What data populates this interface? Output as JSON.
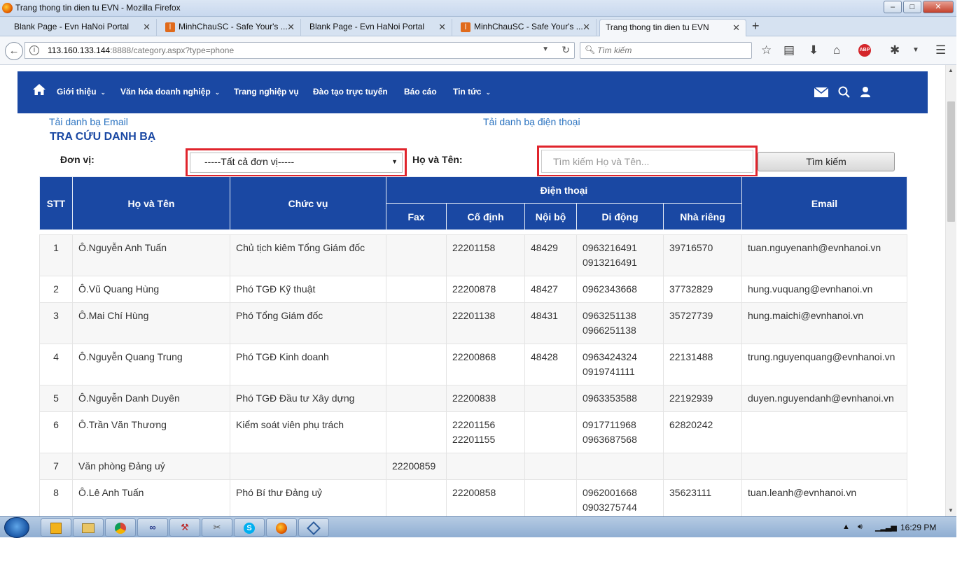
{
  "window": {
    "title": "Trang thong tin dien tu EVN - Mozilla Firefox",
    "minimize": "–",
    "maximize": "□",
    "close": "✕"
  },
  "tabs": [
    {
      "label": "Blank Page - Evn HaNoi Portal",
      "icon": "page-icon",
      "active": false
    },
    {
      "label": "MinhChauSC - Safe Your's ...",
      "icon": "xampp-icon",
      "active": false
    },
    {
      "label": "Blank Page - Evn HaNoi Portal",
      "icon": "page-icon",
      "active": false
    },
    {
      "label": "MinhChauSC - Safe Your's ...",
      "icon": "xampp-icon",
      "active": false
    },
    {
      "label": "Trang thong tin dien tu EVN",
      "icon": "page-icon",
      "active": true
    }
  ],
  "toolbar": {
    "url_host": "113.160.133.144",
    "url_rest": ":8888/category.aspx?type=phone",
    "search_placeholder": "Tìm kiếm"
  },
  "site": {
    "nav_items": [
      {
        "label": "Giới thiệu",
        "has_caret": true
      },
      {
        "label": "Văn hóa doanh nghiệp",
        "has_caret": true
      },
      {
        "label": "Trang nghiệp vụ",
        "has_caret": false
      },
      {
        "label": "Đào tạo trực tuyến",
        "has_caret": false
      },
      {
        "label": "Báo cáo",
        "has_caret": false
      },
      {
        "label": "Tin tức",
        "has_caret": true
      }
    ],
    "brand_color": "#1a48a3"
  },
  "content": {
    "download_email": "Tải danh bạ Email",
    "download_phone": "Tải danh bạ điện thoại",
    "heading": "TRA CỨU DANH BẠ",
    "unit_label": "Đơn vị:",
    "unit_selected": "-----Tất cả đơn vị-----",
    "name_label": "Họ và Tên:",
    "name_placeholder": "Tìm kiếm Họ và Tên...",
    "search_button": "Tìm kiếm"
  },
  "table": {
    "headers": {
      "stt": "STT",
      "name": "Họ và Tên",
      "position": "Chức vụ",
      "phone_group": "Điện thoại",
      "fax": "Fax",
      "landline": "Cố định",
      "internal": "Nội bộ",
      "mobile": "Di động",
      "home": "Nhà riêng",
      "email": "Email"
    },
    "rows": [
      {
        "stt": "1",
        "name": "Ô.Nguyễn Anh Tuấn",
        "position": "Chủ tịch kiêm Tổng Giám đốc",
        "fax": "",
        "landline": [
          "22201158"
        ],
        "internal": "48429",
        "mobile": [
          "0963216491",
          "0913216491"
        ],
        "home": "39716570",
        "email": "tuan.nguyenanh@evnhanoi.vn"
      },
      {
        "stt": "2",
        "name": "Ô.Vũ Quang Hùng",
        "position": "Phó TGĐ Kỹ thuật",
        "fax": "",
        "landline": [
          "22200878"
        ],
        "internal": "48427",
        "mobile": [
          "0962343668"
        ],
        "home": "37732829",
        "email": "hung.vuquang@evnhanoi.vn"
      },
      {
        "stt": "3",
        "name": "Ô.Mai Chí Hùng",
        "position": "Phó Tổng Giám đốc",
        "fax": "",
        "landline": [
          "22201138"
        ],
        "internal": "48431",
        "mobile": [
          "0963251138",
          "0966251138"
        ],
        "home": "35727739",
        "email": "hung.maichi@evnhanoi.vn"
      },
      {
        "stt": "4",
        "name": "Ô.Nguyễn Quang Trung",
        "position": "Phó TGĐ Kinh doanh",
        "fax": "",
        "landline": [
          "22200868"
        ],
        "internal": "48428",
        "mobile": [
          "0963424324",
          "0919741111"
        ],
        "home": "22131488",
        "email": "trung.nguyenquang@evnhanoi.vn"
      },
      {
        "stt": "5",
        "name": "Ô.Nguyễn Danh Duyên",
        "position": "Phó TGĐ Đầu tư Xây dựng",
        "fax": "",
        "landline": [
          "22200838"
        ],
        "internal": "",
        "mobile": [
          "0963353588"
        ],
        "home": "22192939",
        "email": "duyen.nguyendanh@evnhanoi.vn"
      },
      {
        "stt": "6",
        "name": "Ô.Trần Văn Thương",
        "position": "Kiểm soát viên phụ trách",
        "fax": "",
        "landline": [
          "22201156",
          "22201155"
        ],
        "internal": "",
        "mobile": [
          "0917711968",
          "0963687568"
        ],
        "home": "62820242",
        "email": ""
      },
      {
        "stt": "7",
        "name": "Văn phòng Đảng uỷ",
        "position": "",
        "fax": "22200859",
        "landline": [],
        "internal": "",
        "mobile": [],
        "home": "",
        "email": ""
      },
      {
        "stt": "8",
        "name": "Ô.Lê Anh Tuấn",
        "position": "Phó Bí thư Đảng uỷ",
        "fax": "",
        "landline": [
          "22200858"
        ],
        "internal": "",
        "mobile": [
          "0962001668",
          "0903275744"
        ],
        "home": "35623111",
        "email": "tuan.leanh@evnhanoi.vn"
      }
    ]
  },
  "taskbar": {
    "apps": [
      "outlook-icon",
      "explorer-icon",
      "chrome-icon",
      "app-icon",
      "tool-icon",
      "tool-icon",
      "skype-icon",
      "firefox-icon",
      "vm-icon"
    ],
    "time": "16:29 PM"
  },
  "highlight_color": "#e0242c"
}
